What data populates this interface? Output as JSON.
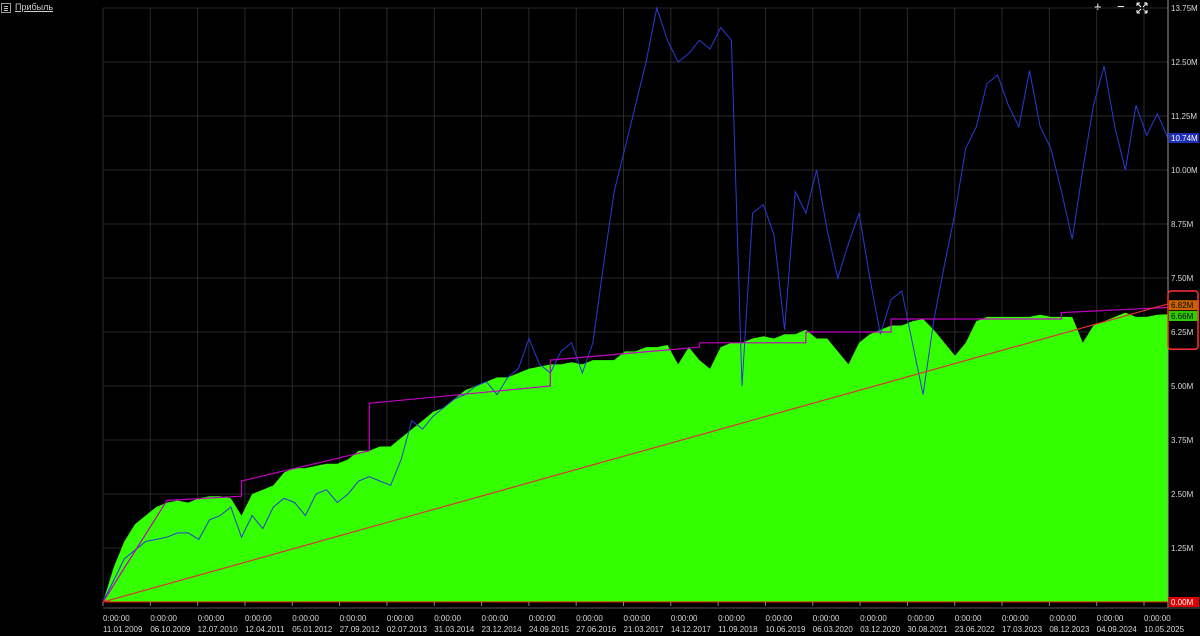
{
  "header": {
    "title": "Прибыль",
    "add_symbol": "+",
    "minimize_symbol": "−"
  },
  "colors": {
    "background": "#000000",
    "grid": "#2a2a2a",
    "area_fill": "#33ff00",
    "equity_line": "#2a3ad6",
    "trend_line": "#e0303a",
    "max_line": "#c000c0",
    "zero_line": "#ff0000",
    "highlight_box": "#ff3030"
  },
  "chart_data": {
    "type": "area",
    "y_axis": {
      "ylim": [
        0,
        13.75
      ],
      "unit": "M",
      "tick_labels": [
        "0.00M",
        "1.25M",
        "2.50M",
        "3.75M",
        "5.00M",
        "6.25M",
        "7.50M",
        "8.75M",
        "10.00M",
        "11.25M",
        "12.50M",
        "13.75M"
      ]
    },
    "x_axis": {
      "time_label": "0:00:00",
      "tick_labels": [
        "11.01.2009",
        "06.10.2009",
        "12.07.2010",
        "12.04.2011",
        "05.01.2012",
        "27.09.2012",
        "02.07.2013",
        "31.03.2014",
        "23.12.2014",
        "24.09.2015",
        "27.06.2016",
        "21.03.2017",
        "14.12.2017",
        "11.09.2018",
        "10.06.2019",
        "06.03.2020",
        "03.12.2020",
        "30.08.2021",
        "23.06.2022",
        "17.03.2023",
        "08.12.2023",
        "04.09.2024",
        "10.05.2025"
      ]
    },
    "grid": true,
    "current_labels": {
      "equity": "10.74M",
      "max": "6.82M",
      "profit": "6.66M",
      "zero": "0.00M"
    },
    "series": [
      {
        "kind": "area",
        "color": "#33ff00",
        "x": [
          0,
          0.01,
          0.02,
          0.03,
          0.04,
          0.05,
          0.06,
          0.07,
          0.08,
          0.09,
          0.1,
          0.11,
          0.12,
          0.13,
          0.14,
          0.15,
          0.16,
          0.17,
          0.18,
          0.19,
          0.2,
          0.21,
          0.22,
          0.23,
          0.24,
          0.25,
          0.26,
          0.27,
          0.28,
          0.29,
          0.3,
          0.31,
          0.32,
          0.33,
          0.34,
          0.35,
          0.36,
          0.37,
          0.38,
          0.39,
          0.4,
          0.41,
          0.42,
          0.43,
          0.44,
          0.45,
          0.46,
          0.47,
          0.48,
          0.49,
          0.5,
          0.51,
          0.52,
          0.53,
          0.54,
          0.55,
          0.56,
          0.57,
          0.58,
          0.59,
          0.6,
          0.61,
          0.62,
          0.63,
          0.64,
          0.65,
          0.66,
          0.67,
          0.68,
          0.69,
          0.7,
          0.71,
          0.72,
          0.73,
          0.74,
          0.75,
          0.76,
          0.77,
          0.78,
          0.79,
          0.8,
          0.81,
          0.82,
          0.83,
          0.84,
          0.85,
          0.86,
          0.87,
          0.88,
          0.89,
          0.9,
          0.91,
          0.92,
          0.93,
          0.94,
          0.95,
          0.96,
          0.97,
          0.98,
          0.99,
          1
        ],
        "values": [
          0.0,
          0.8,
          1.4,
          1.8,
          2.0,
          2.2,
          2.3,
          2.35,
          2.3,
          2.4,
          2.45,
          2.45,
          2.4,
          2.0,
          2.5,
          2.6,
          2.7,
          3.0,
          3.1,
          3.1,
          3.15,
          3.2,
          3.2,
          3.3,
          3.5,
          3.5,
          3.6,
          3.6,
          3.8,
          4.0,
          4.2,
          4.4,
          4.5,
          4.7,
          4.9,
          5.0,
          5.1,
          5.2,
          5.2,
          5.3,
          5.4,
          5.45,
          5.5,
          5.5,
          5.55,
          5.5,
          5.6,
          5.6,
          5.6,
          5.8,
          5.8,
          5.9,
          5.9,
          5.95,
          5.5,
          5.9,
          5.6,
          5.4,
          5.9,
          6.0,
          6.0,
          6.1,
          6.15,
          6.1,
          6.2,
          6.2,
          6.3,
          6.1,
          6.1,
          5.8,
          5.5,
          6.0,
          6.2,
          6.3,
          6.4,
          6.4,
          6.5,
          6.55,
          6.3,
          6.0,
          5.7,
          6.0,
          6.5,
          6.6,
          6.6,
          6.6,
          6.6,
          6.6,
          6.65,
          6.6,
          6.6,
          6.6,
          6.0,
          6.4,
          6.5,
          6.6,
          6.7,
          6.6,
          6.6,
          6.65,
          6.66
        ]
      },
      {
        "kind": "line",
        "name": "equity",
        "color": "#2a3ad6",
        "x": [
          0,
          0.01,
          0.02,
          0.03,
          0.04,
          0.05,
          0.06,
          0.07,
          0.08,
          0.09,
          0.1,
          0.11,
          0.12,
          0.13,
          0.14,
          0.15,
          0.16,
          0.17,
          0.18,
          0.19,
          0.2,
          0.21,
          0.22,
          0.23,
          0.24,
          0.25,
          0.26,
          0.27,
          0.28,
          0.29,
          0.3,
          0.31,
          0.32,
          0.33,
          0.34,
          0.35,
          0.36,
          0.37,
          0.38,
          0.39,
          0.4,
          0.41,
          0.42,
          0.43,
          0.44,
          0.45,
          0.46,
          0.47,
          0.48,
          0.49,
          0.5,
          0.51,
          0.52,
          0.53,
          0.54,
          0.55,
          0.56,
          0.57,
          0.58,
          0.59,
          0.6,
          0.61,
          0.62,
          0.63,
          0.64,
          0.65,
          0.66,
          0.67,
          0.68,
          0.69,
          0.7,
          0.71,
          0.72,
          0.73,
          0.74,
          0.75,
          0.76,
          0.77,
          0.78,
          0.79,
          0.8,
          0.81,
          0.82,
          0.83,
          0.84,
          0.85,
          0.86,
          0.87,
          0.88,
          0.89,
          0.9,
          0.91,
          0.92,
          0.93,
          0.94,
          0.95,
          0.96,
          0.97,
          0.98,
          0.99,
          1
        ],
        "values": [
          0.0,
          0.5,
          1.0,
          1.2,
          1.4,
          1.45,
          1.5,
          1.6,
          1.6,
          1.45,
          1.9,
          2.0,
          2.2,
          1.5,
          2.0,
          1.7,
          2.2,
          2.4,
          2.3,
          2.0,
          2.5,
          2.6,
          2.3,
          2.5,
          2.8,
          2.9,
          2.8,
          2.7,
          3.3,
          4.2,
          4.0,
          4.3,
          4.5,
          4.7,
          4.8,
          5.0,
          5.1,
          4.8,
          5.2,
          5.4,
          6.1,
          5.5,
          5.3,
          5.8,
          6.0,
          5.3,
          6.0,
          7.8,
          9.5,
          10.5,
          11.5,
          12.5,
          13.75,
          13.0,
          12.5,
          12.7,
          13.0,
          12.8,
          13.3,
          13.0,
          5.0,
          9.0,
          9.2,
          8.5,
          6.3,
          9.5,
          9.0,
          10.0,
          8.6,
          7.5,
          8.3,
          9.0,
          7.5,
          6.2,
          7.0,
          7.2,
          6.0,
          4.8,
          6.5,
          7.8,
          9.0,
          10.5,
          11.0,
          12.0,
          12.2,
          11.5,
          11.0,
          12.3,
          11.0,
          10.5,
          9.5,
          8.4,
          10.0,
          11.5,
          12.4,
          11.0,
          10.0,
          11.5,
          10.8,
          11.3,
          10.74
        ]
      },
      {
        "kind": "line",
        "name": "max",
        "color": "#c000c0",
        "x": [
          0,
          0.06,
          0.13,
          0.13,
          0.25,
          0.25,
          0.42,
          0.42,
          0.56,
          0.56,
          0.66,
          0.66,
          0.74,
          0.74,
          0.9,
          0.9,
          1
        ],
        "values": [
          0,
          2.35,
          2.45,
          2.8,
          3.5,
          4.6,
          5.0,
          5.6,
          5.9,
          6.0,
          6.0,
          6.25,
          6.25,
          6.55,
          6.55,
          6.7,
          6.82
        ]
      },
      {
        "kind": "line",
        "name": "trend",
        "color": "#e0303a",
        "x": [
          0,
          1
        ],
        "values": [
          0,
          6.9
        ]
      }
    ]
  }
}
